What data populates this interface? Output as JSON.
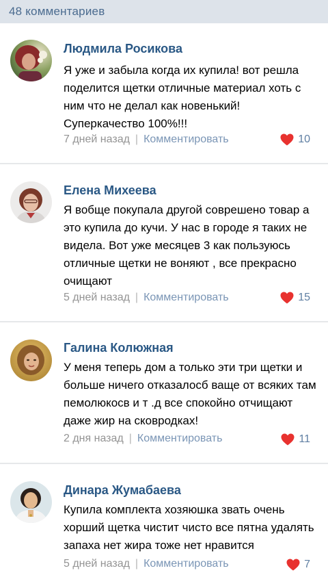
{
  "header": {
    "count_label": "48 комментариев"
  },
  "comments": [
    {
      "author": "Людмила Росикова",
      "text": "Я уже и забыла когда их купила! вот решла поделится щетки отличные материал хоть с ним что не делал как новенький! Суперкачество 100%!!!",
      "time": "7 дней назад",
      "reply_label": "Комментировать",
      "likes": "10"
    },
    {
      "author": "Елена Михеева",
      "text": "Я вобще покупала другой соврешено товар а это купила до кучи. У нас в городе я таких не видела. Вот уже месяцев 3 как пользуюсь отличные щетки не воняют , все прекрасно очищают",
      "time": "5 дней назад",
      "reply_label": "Комментировать",
      "likes": "15"
    },
    {
      "author": "Галина Колюжная",
      "text": "У меня теперь дом а только эти три щетки и больше ничего отказалосб ваще от всяких там пемолюкосв и т .д все спокойно отчищают даже жир на сковродках!",
      "time": "2 дня назад",
      "reply_label": "Комментировать",
      "likes": "11"
    },
    {
      "author": "Динара Жумабаева",
      "text": "Купила комплекта хозяюшка звать очень хорший щетка чистит чисто все пятна удалять запаха нет жира тоже нет нравится",
      "time": "5 дней назад",
      "reply_label": "Комментировать",
      "likes": "7"
    }
  ],
  "colors": {
    "header_bg": "#dde3ea",
    "header_text": "#4a6b8f",
    "author_name": "#2a5885",
    "meta_text": "#939393",
    "reply_link": "#7a95b5",
    "likes_text": "#5f7fa3",
    "heart": "#e8322f",
    "divider": "#e6e8ea"
  },
  "icons": {
    "like": "heart-icon"
  }
}
